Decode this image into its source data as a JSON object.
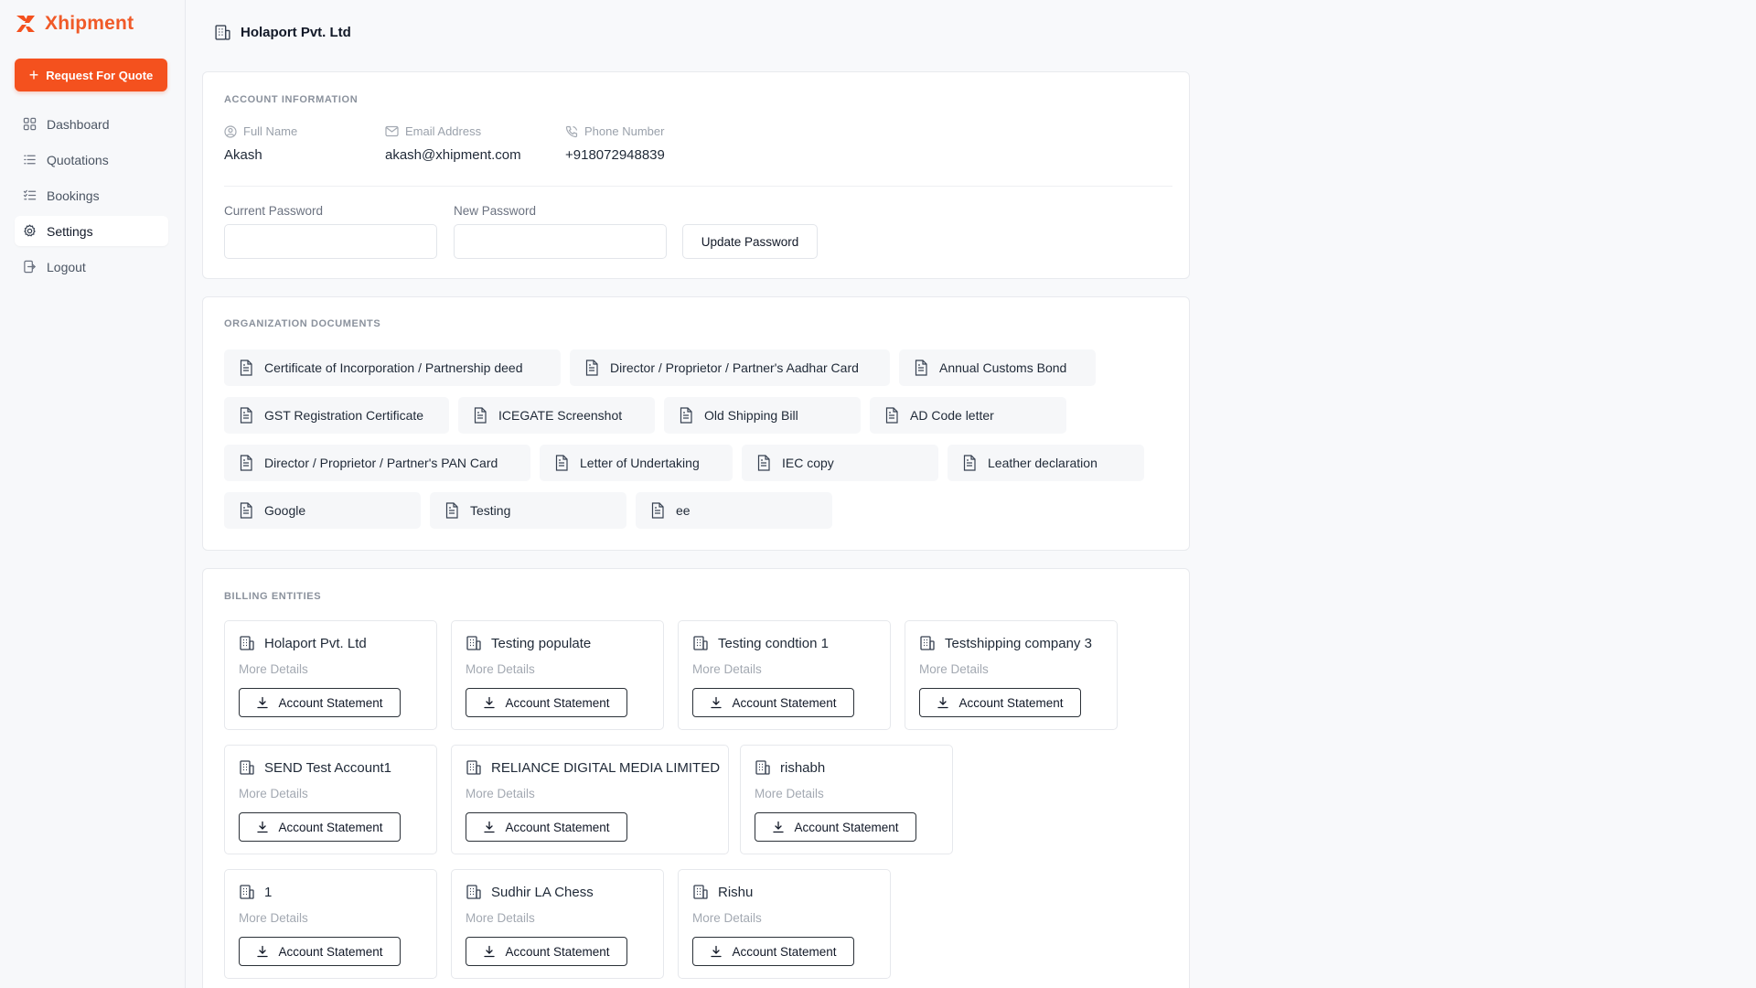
{
  "brand": {
    "name": "Xhipment",
    "accent": "#f4511e"
  },
  "sidebar": {
    "cta_label": "Request For Quote",
    "items": [
      {
        "label": "Dashboard",
        "icon": "grid-icon"
      },
      {
        "label": "Quotations",
        "icon": "list-icon"
      },
      {
        "label": "Bookings",
        "icon": "checklist-icon"
      },
      {
        "label": "Settings",
        "icon": "gear-icon",
        "active": true
      },
      {
        "label": "Logout",
        "icon": "logout-icon"
      }
    ]
  },
  "header": {
    "title": "Holaport Pvt. Ltd",
    "icon": "building-icon"
  },
  "account": {
    "section_title": "ACCOUNT INFORMATION",
    "full_name_label": "Full Name",
    "full_name": "Akash",
    "email_label": "Email Address",
    "email": "akash@xhipment.com",
    "phone_label": "Phone Number",
    "phone": "+918072948839",
    "current_password_label": "Current Password",
    "new_password_label": "New Password",
    "update_button": "Update Password"
  },
  "documents": {
    "section_title": "ORGANIZATION DOCUMENTS",
    "items": [
      "Certificate of Incorporation / Partnership deed",
      "Director / Proprietor / Partner's Aadhar Card",
      "Annual Customs Bond",
      "GST Registration Certificate",
      "ICEGATE Screenshot",
      "Old Shipping Bill",
      "AD Code letter",
      "Director / Proprietor / Partner's PAN Card",
      "Letter of Undertaking",
      "IEC copy",
      "Leather declaration",
      "Google",
      "Testing",
      "ee"
    ]
  },
  "billing": {
    "section_title": "BILLING ENTITIES",
    "more_label": "More Details",
    "statement_label": "Account Statement",
    "entities": [
      "Holaport Pvt. Ltd",
      "Testing populate",
      "Testing condtion 1",
      "Testshipping company 3",
      "SEND Test Account1",
      "RELIANCE DIGITAL MEDIA LIMITED",
      "rishabh",
      "1",
      "Sudhir LA Chess",
      "Rishu"
    ]
  }
}
